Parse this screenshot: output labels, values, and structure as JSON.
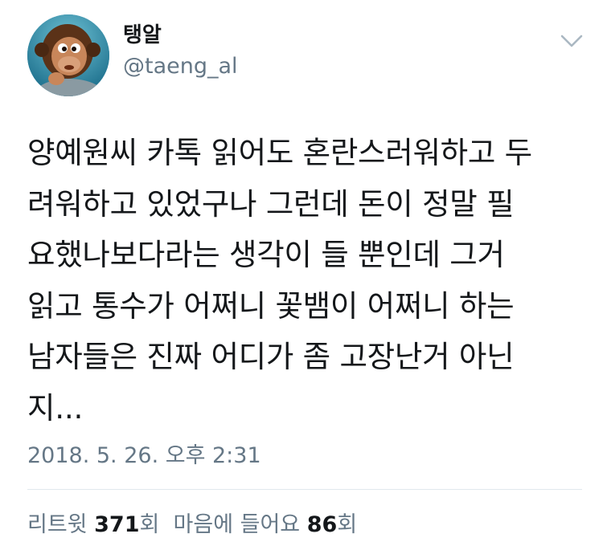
{
  "user": {
    "display_name": "탱알",
    "handle": "@taeng_al",
    "avatar_icon": "monkey-puppet-avatar"
  },
  "menu": {
    "icon": "chevron-down-icon"
  },
  "tweet": {
    "lines": [
      "양예원씨 카톡 읽어도 혼란스러워하고 두",
      "려워하고 있었구나 그런데 돈이 정말 필",
      "요했나보다라는 생각이 들 뿐인데 그거",
      "읽고 통수가 어쩌니 꽃뱀이 어쩌니 하는",
      "남자들은 진짜 어디가 좀 고장난거 아닌",
      "지..."
    ],
    "timestamp": "2018. 5. 26. 오후 2:31"
  },
  "stats": {
    "retweets_label": "리트윗",
    "retweets_count": "371",
    "retweets_unit": "회",
    "likes_label": "마음에 들어요",
    "likes_count": "86",
    "likes_unit": "회"
  },
  "colors": {
    "text_primary": "#14171a",
    "text_secondary": "#657786",
    "divider": "#e1e8ed"
  }
}
